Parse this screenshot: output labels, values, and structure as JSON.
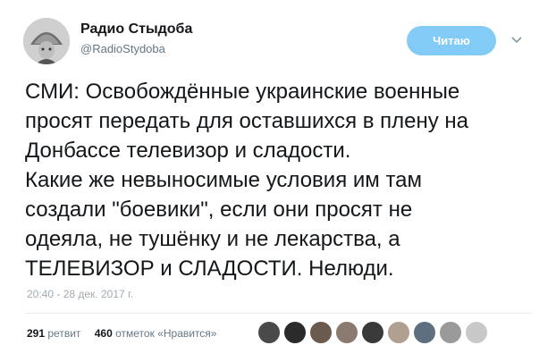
{
  "header": {
    "display_name": "Радио Стыдоба",
    "handle": "@RadioStydoba",
    "follow_label": "Читаю"
  },
  "tweet": {
    "lines": [
      "СМИ: Освобождённые украинские военные",
      "просят передать для оставшихся в плену на",
      "Донбассе телевизор и сладости.",
      "Какие же невыносимые условия им там",
      "создали \"боевики\", если они просят не",
      "одеяла, не тушёнку и не лекарства, а",
      "ТЕЛЕВИЗОР и СЛАДОСТИ. Нелюди."
    ],
    "timestamp": "20:40 - 28 дек. 2017 г."
  },
  "stats": {
    "retweets_count": "291",
    "retweets_label": "ретвит",
    "likes_count": "460",
    "likes_label": "отметок «Нравится»"
  },
  "likers": [
    {
      "name": "liker-avatar-1",
      "color": "#4a4a4a"
    },
    {
      "name": "liker-avatar-2",
      "color": "#2b2b2b"
    },
    {
      "name": "liker-avatar-3",
      "color": "#6b5a4e"
    },
    {
      "name": "liker-avatar-4",
      "color": "#8a7a70"
    },
    {
      "name": "liker-avatar-5",
      "color": "#3a3a3a"
    },
    {
      "name": "liker-avatar-6",
      "color": "#b0a090"
    },
    {
      "name": "liker-avatar-7",
      "color": "#5f6f80"
    },
    {
      "name": "liker-avatar-8",
      "color": "#9a9a9a"
    },
    {
      "name": "liker-avatar-9",
      "color": "#c8c8c8"
    }
  ],
  "colors": {
    "accent": "#1da1f2",
    "text": "#14171a",
    "secondary": "#657786"
  }
}
